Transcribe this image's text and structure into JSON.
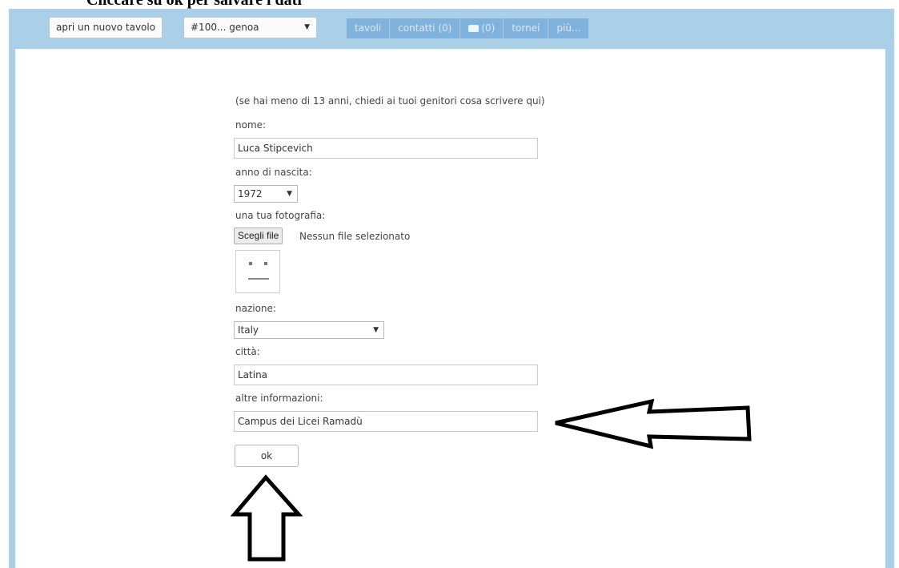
{
  "caption": "Cliccare su ok per salvare i dati",
  "toolbar": {
    "new_table_label": "apri un nuovo tavolo",
    "room_select_value": "#100... genoa",
    "menu": {
      "tables": "tavoli",
      "contacts": "contatti (0)",
      "chat": "(0)",
      "tournaments": "tornei",
      "more": "più..."
    }
  },
  "form": {
    "note": "(se hai meno di 13 anni, chiedi ai tuoi genitori cosa scrivere qui)",
    "name_label": "nome:",
    "name_value": "Luca Stipcevich",
    "birth_year_label": "anno di nascita:",
    "birth_year_value": "1972",
    "photo_label": "una tua fotografia:",
    "file_button": "Scegli file",
    "file_status": "Nessun file selezionato",
    "country_label": "nazione:",
    "country_value": "Italy",
    "city_label": "città:",
    "city_value": "Latina",
    "other_label": "altre informazioni:",
    "other_value": "Campus dei Licei Ramadù",
    "ok_button": "ok"
  },
  "icons": {
    "dropdown": "chevron-down-icon",
    "chat": "chat-bubble-icon",
    "avatar_placeholder": "face-placeholder-icon",
    "annotation_left": "arrow-left-outline-icon",
    "annotation_up": "arrow-up-outline-icon"
  },
  "colors": {
    "frame": "#a9cfe9",
    "menu_bar": "#7fb2dd",
    "menu_text": "#dbeaf7"
  }
}
